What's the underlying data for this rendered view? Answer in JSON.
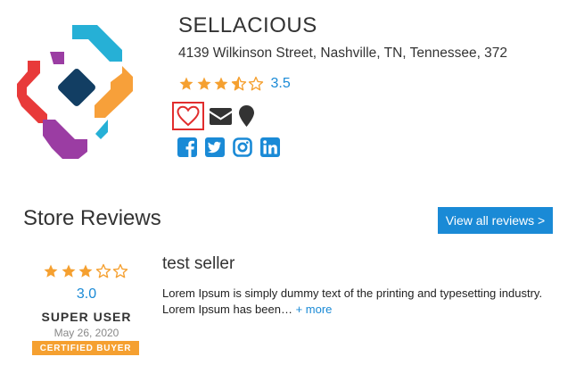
{
  "store": {
    "name": "SELLACIOUS",
    "address": "4139 Wilkinson Street, Nashville, TN, Tennessee, 372",
    "rating": 3.5,
    "rating_label": "3.5"
  },
  "actions": {
    "favorite_icon": "heart-outline-icon",
    "email_icon": "envelope-icon",
    "location_icon": "map-marker-icon"
  },
  "social": {
    "icons": [
      "facebook-icon",
      "twitter-icon",
      "instagram-icon",
      "linkedin-icon"
    ]
  },
  "reviews_section": {
    "title": "Store Reviews",
    "view_all_label": "View all reviews >"
  },
  "reviews": [
    {
      "rating": 3.0,
      "rating_label": "3.0",
      "author": "SUPER USER",
      "date": "May 26, 2020",
      "badge": "CERTIFIED BUYER",
      "title": "test seller",
      "text": "Lorem Ipsum is simply dummy text of the printing and typesetting industry. Lorem Ipsum has been…",
      "more_label": "+ more"
    }
  ],
  "colors": {
    "star": "#f5a030",
    "link": "#1a8ad6",
    "button": "#1a8ad6",
    "favorite_border": "#e12d2d",
    "social": "#1a8ad6",
    "badge": "#f5a030"
  }
}
